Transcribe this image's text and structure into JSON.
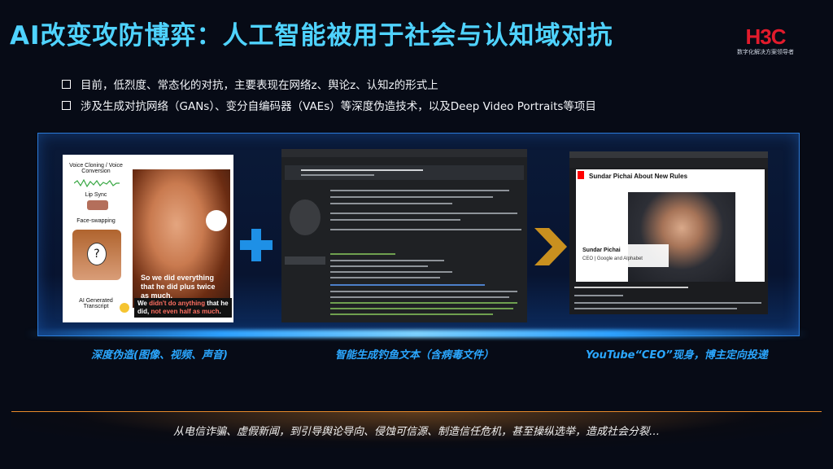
{
  "slide": {
    "title": "AI改变攻防博弈：人工智能被用于社会与认知域对抗",
    "logo": {
      "mark": "H3C",
      "tagline": "数字化解决方案领导者"
    },
    "bullets": [
      "目前，低烈度、常态化的对抗，主要表现在网络z、舆论z、认知z的形式上",
      "涉及生成对抗网络（GANs）、变分自编码器（VAEs）等深度伪造技术，以及Deep Video Portraits等项目"
    ],
    "captions": [
      "深度伪造(图像、视频、声音)",
      "智能生成钓鱼文本（含病毒文件）",
      "YouTube“CEO”现身，博主定向投递"
    ],
    "bottom_text": "从电信诈骗、虚假新闻，到引导舆论导向、侵蚀可信源、制造信任危机，甚至操纵选举，造成社会分裂…"
  },
  "deepfake_figure": {
    "labels": [
      "Voice Cloning / Voice Conversion",
      "Lip Sync",
      "Face-swapping",
      "AI Generated Transcript"
    ],
    "subtitle_top": "So we did everything that he did plus twice as much.",
    "subtitle_bottom_prefix": "We ",
    "subtitle_bottom_highlight": "didn't do anything",
    "subtitle_bottom_mid": " that he did, ",
    "subtitle_bottom_highlight2": "not even half as much",
    "subtitle_bottom_end": "."
  },
  "youtube_figure": {
    "video_title": "Sundar Pichai About New Rules",
    "lower_third_name": "Sundar Pichai",
    "lower_third_role": "CEO | Google and Alphabet"
  },
  "colors": {
    "title": "#4fd3ff",
    "caption": "#2ba7ff",
    "logo": "#e21b2c",
    "accent_bar": "#e88a2a"
  }
}
